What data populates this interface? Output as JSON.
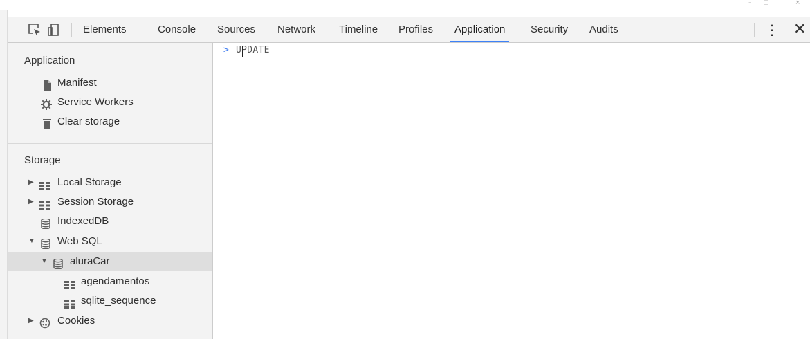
{
  "window_controls": [
    "-",
    "□",
    "×"
  ],
  "toolbar": {
    "tabs": [
      {
        "label": "Elements"
      },
      {
        "label": "Console"
      },
      {
        "label": "Sources"
      },
      {
        "label": "Network"
      },
      {
        "label": "Timeline"
      },
      {
        "label": "Profiles"
      },
      {
        "label": "Application",
        "active": true
      },
      {
        "label": "Security"
      },
      {
        "label": "Audits"
      }
    ],
    "more_icon": "⋮",
    "close_icon": "✕",
    "accent": "#3e82f7"
  },
  "sidebar": {
    "application": {
      "title": "Application",
      "items": [
        {
          "label": "Manifest",
          "icon": "file-icon"
        },
        {
          "label": "Service Workers",
          "icon": "gear-icon"
        },
        {
          "label": "Clear storage",
          "icon": "trash-icon"
        }
      ]
    },
    "storage": {
      "title": "Storage",
      "items": [
        {
          "label": "Local Storage",
          "icon": "grid-icon",
          "expandable": true
        },
        {
          "label": "Session Storage",
          "icon": "grid-icon",
          "expandable": true
        },
        {
          "label": "IndexedDB",
          "icon": "database-icon"
        },
        {
          "label": "Web SQL",
          "icon": "database-icon",
          "expanded": true
        },
        {
          "label": "aluraCar",
          "icon": "database-icon",
          "expanded": true,
          "selected": true
        },
        {
          "label": "agendamentos",
          "icon": "grid-icon"
        },
        {
          "label": "sqlite_sequence",
          "icon": "grid-icon"
        },
        {
          "label": "Cookies",
          "icon": "cookie-icon",
          "expandable": true
        }
      ]
    }
  },
  "console": {
    "prompt": ">",
    "input_value": "UPDATE"
  }
}
